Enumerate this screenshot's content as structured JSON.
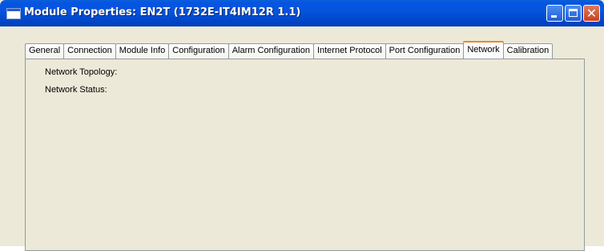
{
  "window": {
    "title": "Module Properties: EN2T (1732E-IT4IM12R 1.1)"
  },
  "caption_buttons": {
    "minimize_icon": "minimize-icon",
    "maximize_icon": "maximize-icon",
    "close_glyph": "✕"
  },
  "tabs": [
    {
      "label": "General",
      "active": false
    },
    {
      "label": "Connection",
      "active": false
    },
    {
      "label": "Module Info",
      "active": false
    },
    {
      "label": "Configuration",
      "active": false
    },
    {
      "label": "Alarm Configuration",
      "active": false
    },
    {
      "label": "Internet Protocol",
      "active": false
    },
    {
      "label": "Port Configuration",
      "active": false
    },
    {
      "label": "Network",
      "active": true
    },
    {
      "label": "Calibration",
      "active": false
    }
  ],
  "network_tab": {
    "topology_label": "Network Topology:",
    "status_label": "Network Status:"
  },
  "colors": {
    "titlebar": "#0054E3",
    "dialog_bg": "#ECE9D8",
    "active_tab_accent": "#E68B2C"
  }
}
